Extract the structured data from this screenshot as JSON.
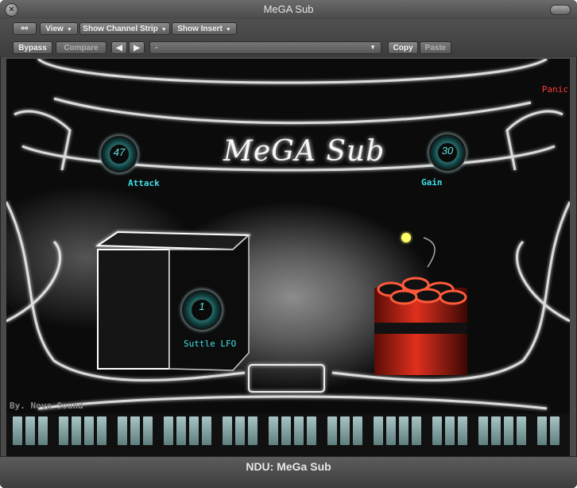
{
  "window": {
    "title": "MeGA Sub",
    "footer_title": "NDU: MeGa Sub"
  },
  "toolbar": {
    "link_button": "link-icon",
    "view_label": "View",
    "channel_strip_label": "Show Channel Strip",
    "show_insert_label": "Show Insert",
    "bypass_label": "Bypass",
    "compare_label": "Compare",
    "prev_label": "◀",
    "next_label": "▶",
    "preset_value": "-",
    "copy_label": "Copy",
    "paste_label": "Paste"
  },
  "plugin": {
    "title": "MeGA Sub",
    "panic_label": "Panic",
    "credit": "By. Nova Sound",
    "knobs": {
      "attack": {
        "label": "Attack",
        "value": "47"
      },
      "gain": {
        "label": "Gain",
        "value": "30"
      },
      "lfo": {
        "label": "Suttle LFO",
        "value": "1"
      }
    }
  },
  "colors": {
    "accent": "#3fe0e6",
    "panic": "#ff3b3b",
    "dynamite": "#e0301e"
  }
}
